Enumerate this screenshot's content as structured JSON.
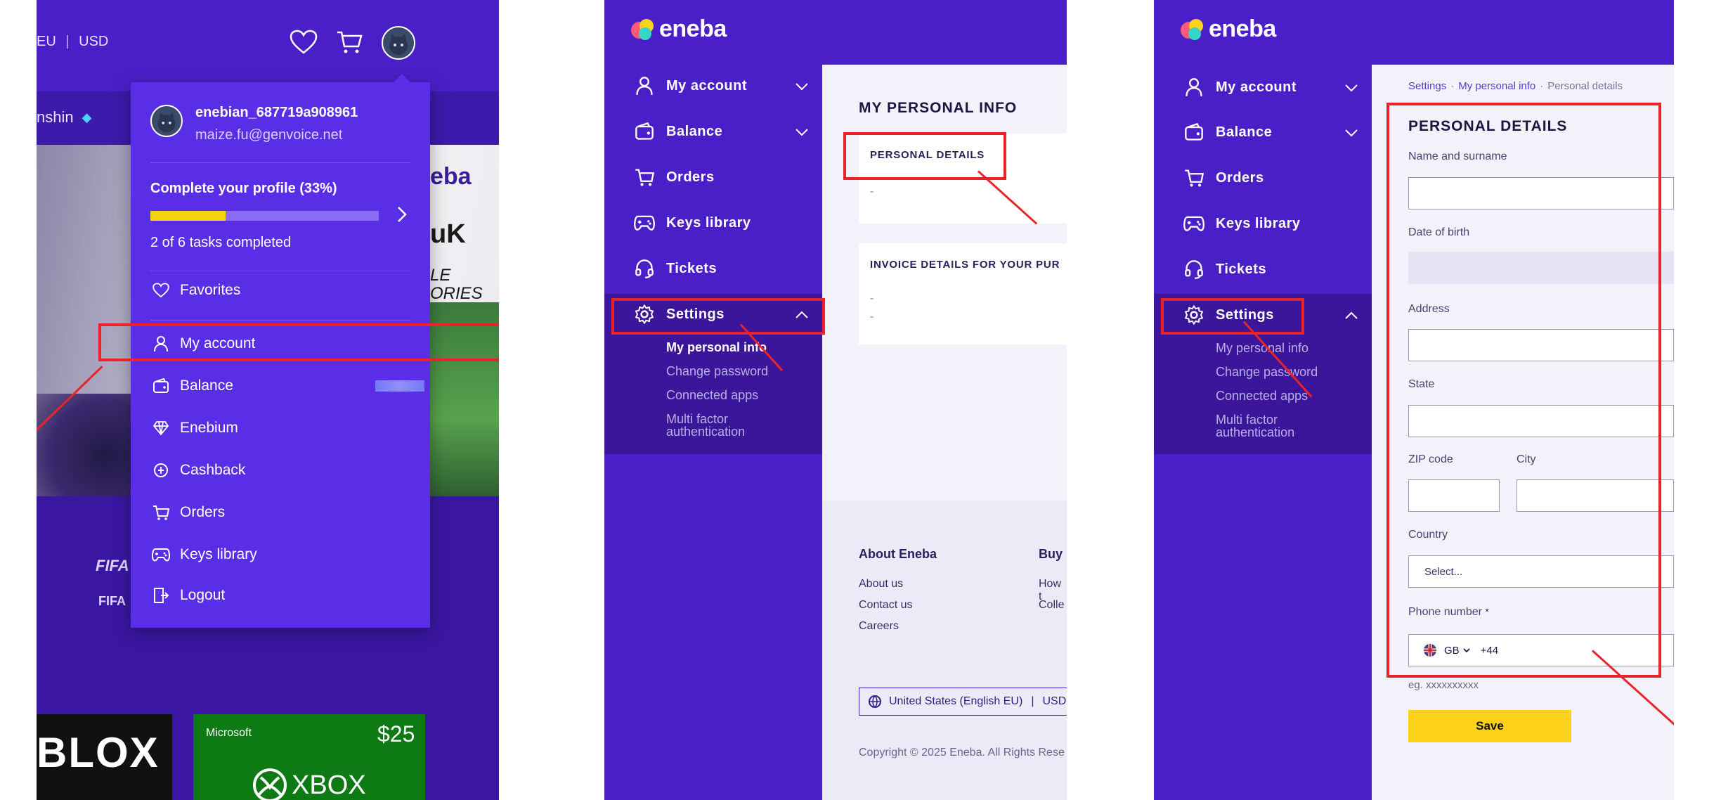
{
  "panel1": {
    "region_text": "EU",
    "currency": "USD",
    "game_tab": "nshin",
    "brand_partial": "eba",
    "banner_text1": "uK",
    "banner_text2": "LE",
    "banner_text3": "ORIES",
    "fifa_a": "FIFA",
    "fifa_b": "FIFA",
    "card1_text": "BLOX",
    "card2_brand": "Microsoft",
    "card2_price": "$25",
    "card2_product": "XBOX",
    "menu": {
      "username": "enebian_687719a908961",
      "email": "maize.fu@genvoice.net",
      "profile_title": "Complete your profile (33%)",
      "profile_progress": 0.33,
      "tasks_text": "2 of 6 tasks completed",
      "favorites": "Favorites",
      "items": [
        "My account",
        "Balance",
        "Enebium",
        "Cashback",
        "Orders",
        "Keys library",
        "Logout"
      ]
    }
  },
  "sidebar": {
    "logo": "eneba",
    "items": [
      "My account",
      "Balance",
      "Orders",
      "Keys library",
      "Tickets",
      "Settings"
    ],
    "sub": [
      "My personal info",
      "Change password",
      "Connected apps",
      "Multi factor",
      "authentication"
    ]
  },
  "panel2": {
    "title": "MY PERSONAL INFO",
    "personal_details": "PERSONAL DETAILS",
    "dash": "-",
    "invoice_title": "INVOICE DETAILS FOR YOUR PUR",
    "footer": {
      "about_title": "About Eneba",
      "buy_title": "Buy",
      "links": [
        "About us",
        "Contact us",
        "Careers"
      ],
      "buy_links": [
        "How t",
        "Colle"
      ],
      "locale": "United States (English EU)",
      "locale_sep": "|",
      "currency": "USD",
      "copyright": "Copyright © 2025 Eneba. All Rights Rese"
    }
  },
  "panel3": {
    "breadcrumb": [
      "Settings",
      "·",
      "My personal info",
      "·",
      "Personal details"
    ],
    "title": "PERSONAL DETAILS",
    "labels": {
      "name": "Name and surname",
      "dob": "Date of birth",
      "address": "Address",
      "state": "State",
      "zip": "ZIP code",
      "city": "City",
      "country": "Country",
      "phone": "Phone number",
      "required_mark": "*"
    },
    "country_placeholder": "Select...",
    "phone_country": "GB",
    "phone_prefix": "+44",
    "phone_example": "eg. xxxxxxxxxx",
    "save": "Save"
  },
  "colors": {
    "brand_purple": "#4b1fc8",
    "menu_purple": "#5a2de6",
    "progress_yellow": "#f5d60e",
    "save_yellow": "#fbd11a",
    "annotation_red": "#e8242a"
  }
}
